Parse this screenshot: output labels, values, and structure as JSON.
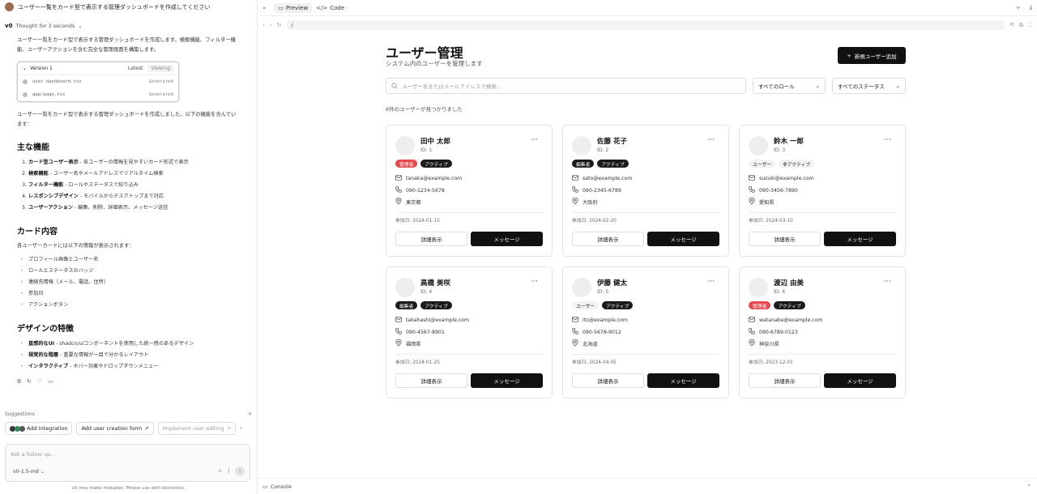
{
  "chat": {
    "user_prompt": "ユーザー一覧をカード型で表示する管理ダッシュボードを作成してください",
    "thought": "Thought for 3 seconds",
    "intro": "ユーザー一覧をカード型で表示する管理ダッシュボードを作成します。検索機能、フィルター機能、ユーザーアクションを含む完全な管理画面を構築します。",
    "version": {
      "label": "Version 1",
      "latest": "Latest",
      "viewing": "Viewing",
      "files": [
        {
          "name": "user-dashboard.tsx",
          "status": "Generated"
        },
        {
          "name": "app/page.tsx",
          "status": "Generated"
        }
      ]
    },
    "summary": "ユーザー一覧をカード型で表示する管理ダッシュボードを作成しました。以下の機能を含んでいます：",
    "section1": {
      "title": "主な機能",
      "items": [
        {
          "bold": "カード型ユーザー表示",
          "text": " - 各ユーザーの情報を見やすいカード形式で表示"
        },
        {
          "bold": "検索機能",
          "text": " - ユーザー名やメールアドレスでリアルタイム検索"
        },
        {
          "bold": "フィルター機能",
          "text": " - ロールやステータスで絞り込み"
        },
        {
          "bold": "レスポンシブデザイン",
          "text": " - モバイルからデスクトップまで対応"
        },
        {
          "bold": "ユーザーアクション",
          "text": " - 編集、削除、詳細表示、メッセージ送信"
        }
      ]
    },
    "section2": {
      "title": "カード内容",
      "desc": "各ユーザーカードには以下の情報が表示されます：",
      "items": [
        "プロフィール画像とユーザー名",
        "ロールとステータスのバッジ",
        "連絡先情報（メール、電話、住所）",
        "参加日",
        "アクションボタン"
      ]
    },
    "section3": {
      "title": "デザインの特徴",
      "items": [
        {
          "bold": "直感的なUI",
          "text": " - shadcn/uiコンポーネントを使用した統一感のあるデザイン"
        },
        {
          "bold": "視覚的な階層",
          "text": " - 重要な情報が一目で分かるレイアウト"
        },
        {
          "bold": "インタラクティブ",
          "text": " - ホバー効果やドロップダウンメニュー"
        }
      ]
    },
    "suggestions": {
      "label": "Suggestions",
      "items": [
        "Add Integration",
        "Add user creation form",
        "Implement user editing"
      ]
    },
    "composer": {
      "placeholder": "Ask a follow up...",
      "model": "v0-1.5-md"
    },
    "disclaimer": "v0 may make mistakes. Please use with discretion."
  },
  "toolbar": {
    "preview": "Preview",
    "code": "Code",
    "url": "/",
    "console": "Console"
  },
  "dashboard": {
    "title": "ユーザー管理",
    "subtitle": "システム内のユーザーを管理します",
    "add_button": "新規ユーザー追加",
    "search_placeholder": "ユーザー名またはメールアドレスで検索...",
    "role_filter": "すべてのロール",
    "status_filter": "すべてのステータス",
    "count_text": "6件のユーザーが見つかりました",
    "detail_label": "詳細表示",
    "message_label": "メッセージ",
    "users": [
      {
        "name": "田中 太郎",
        "id": "ID: 1",
        "role": "管理者",
        "role_style": "red",
        "status": "アクティブ",
        "status_style": "dark",
        "email": "tanaka@example.com",
        "phone": "090-1234-5678",
        "location": "東京都",
        "joined": "参加日: 2024-01-15"
      },
      {
        "name": "佐藤 花子",
        "id": "ID: 2",
        "role": "編集者",
        "role_style": "dark",
        "status": "アクティブ",
        "status_style": "dark",
        "email": "sato@example.com",
        "phone": "090-2345-6789",
        "location": "大阪府",
        "joined": "参加日: 2024-02-20"
      },
      {
        "name": "鈴木 一郎",
        "id": "ID: 3",
        "role": "ユーザー",
        "role_style": "light",
        "status": "非アクティブ",
        "status_style": "light",
        "email": "suzuki@example.com",
        "phone": "090-3456-7890",
        "location": "愛知県",
        "joined": "参加日: 2024-03-10"
      },
      {
        "name": "高橋 美咲",
        "id": "ID: 4",
        "role": "編集者",
        "role_style": "dark",
        "status": "アクティブ",
        "status_style": "dark",
        "email": "takahashi@example.com",
        "phone": "090-4567-8901",
        "location": "福岡県",
        "joined": "参加日: 2024-01-25"
      },
      {
        "name": "伊藤 健太",
        "id": "ID: 5",
        "role": "ユーザー",
        "role_style": "light",
        "status": "アクティブ",
        "status_style": "dark",
        "email": "ito@example.com",
        "phone": "090-5678-9012",
        "location": "北海道",
        "joined": "参加日: 2024-04-05"
      },
      {
        "name": "渡辺 由美",
        "id": "ID: 6",
        "role": "管理者",
        "role_style": "red",
        "status": "アクティブ",
        "status_style": "dark",
        "email": "watanabe@example.com",
        "phone": "090-6789-0123",
        "location": "神奈川県",
        "joined": "参加日: 2023-12-01"
      }
    ]
  }
}
